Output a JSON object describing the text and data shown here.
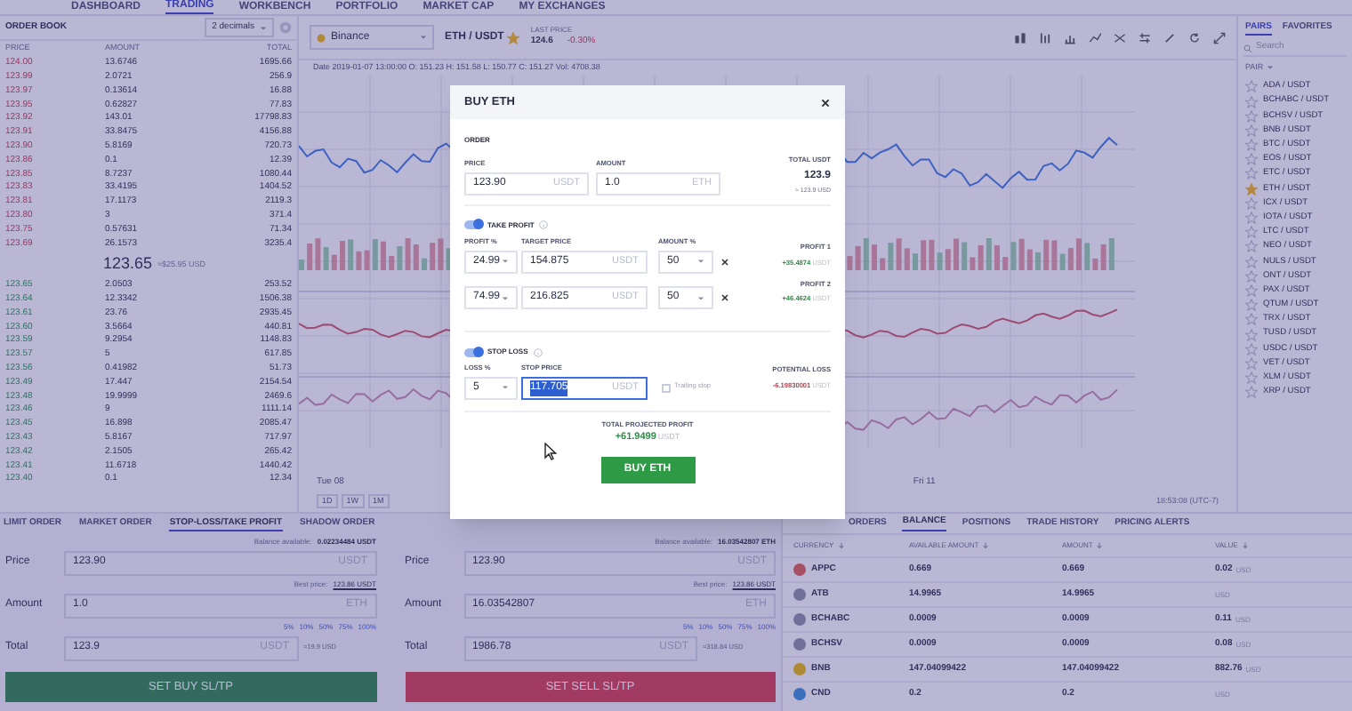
{
  "nav": [
    {
      "label": "DASHBOARD",
      "selected": false
    },
    {
      "label": "TRADING",
      "selected": true
    },
    {
      "label": "WORKBENCH",
      "selected": false
    },
    {
      "label": "PORTFOLIO",
      "selected": false
    },
    {
      "label": "MARKET CAP",
      "selected": false
    },
    {
      "label": "MY EXCHANGES",
      "selected": false
    }
  ],
  "order_book": {
    "title": "ORDER BOOK",
    "decimals": "2 decimals",
    "columns": [
      "PRICE",
      "AMOUNT",
      "TOTAL"
    ],
    "asks": [
      {
        "price": "124.00",
        "amount": "13.6746",
        "total": "1695.66"
      },
      {
        "price": "123.99",
        "amount": "2.0721",
        "total": "256.9"
      },
      {
        "price": "123.97",
        "amount": "0.13614",
        "total": "16.88"
      },
      {
        "price": "123.95",
        "amount": "0.62827",
        "total": "77.83"
      },
      {
        "price": "123.92",
        "amount": "143.01",
        "total": "17798.83"
      },
      {
        "price": "123.91",
        "amount": "33.8475",
        "total": "4156.88"
      },
      {
        "price": "123.90",
        "amount": "5.8169",
        "total": "720.73"
      },
      {
        "price": "123.86",
        "amount": "0.1",
        "total": "12.39"
      },
      {
        "price": "123.85",
        "amount": "8.7237",
        "total": "1080.44"
      },
      {
        "price": "123.83",
        "amount": "33.4195",
        "total": "1404.52"
      },
      {
        "price": "123.81",
        "amount": "17.1173",
        "total": "2119.3"
      },
      {
        "price": "123.80",
        "amount": "3",
        "total": "371.4"
      },
      {
        "price": "123.75",
        "amount": "0.57631",
        "total": "71.34"
      },
      {
        "price": "123.69",
        "amount": "26.1573",
        "total": "3235.4"
      }
    ],
    "last_price": "123.65",
    "last_price_usd": "≈$25.95 USD",
    "bids": [
      {
        "price": "123.65",
        "amount": "2.0503",
        "total": "253.52"
      },
      {
        "price": "123.64",
        "amount": "12.3342",
        "total": "1506.38"
      },
      {
        "price": "123.61",
        "amount": "23.76",
        "total": "2935.45"
      },
      {
        "price": "123.60",
        "amount": "3.5664",
        "total": "440.81"
      },
      {
        "price": "123.59",
        "amount": "9.2954",
        "total": "1148.83"
      },
      {
        "price": "123.57",
        "amount": "5",
        "total": "617.85"
      },
      {
        "price": "123.56",
        "amount": "0.41982",
        "total": "51.73"
      },
      {
        "price": "123.49",
        "amount": "17.447",
        "total": "2154.54"
      },
      {
        "price": "123.48",
        "amount": "19.9999",
        "total": "2469.6"
      },
      {
        "price": "123.46",
        "amount": "9",
        "total": "1111.14"
      },
      {
        "price": "123.45",
        "amount": "16.898",
        "total": "2085.47"
      },
      {
        "price": "123.43",
        "amount": "5.8167",
        "total": "717.97"
      },
      {
        "price": "123.42",
        "amount": "2.1505",
        "total": "265.42"
      },
      {
        "price": "123.41",
        "amount": "11.6718",
        "total": "1440.42"
      },
      {
        "price": "123.40",
        "amount": "0.1",
        "total": "12.34"
      }
    ]
  },
  "chart": {
    "exchange": "Binance",
    "pair": "ETH / USDT",
    "favorite": true,
    "last_price_label": "LAST PRICE",
    "last_price": "124.6",
    "change": "-0.30%",
    "ohlc": "Date 2019-01-07 13:00:00 O: 151.23 H: 151.58 L: 150.77 C: 151.27 Vol: 4708.38",
    "date_labels": [
      "Tue 08",
      "Fri 11"
    ],
    "timeframes": [
      "1D",
      "1W",
      "1M"
    ],
    "clock": "18:53:08 (UTC-7)"
  },
  "pairs": {
    "tabs": [
      {
        "label": "PAIRS",
        "selected": true
      },
      {
        "label": "FAVORITES",
        "selected": false
      }
    ],
    "search": {
      "placeholder": "Search"
    },
    "header": "PAIR",
    "items": [
      {
        "name": "ADA / USDT",
        "favorite": false
      },
      {
        "name": "BCHABC / USDT",
        "favorite": false
      },
      {
        "name": "BCHSV / USDT",
        "favorite": false
      },
      {
        "name": "BNB / USDT",
        "favorite": false
      },
      {
        "name": "BTC / USDT",
        "favorite": false
      },
      {
        "name": "EOS / USDT",
        "favorite": false
      },
      {
        "name": "ETC / USDT",
        "favorite": false
      },
      {
        "name": "ETH / USDT",
        "favorite": true
      },
      {
        "name": "ICX / USDT",
        "favorite": false
      },
      {
        "name": "IOTA / USDT",
        "favorite": false
      },
      {
        "name": "LTC / USDT",
        "favorite": false
      },
      {
        "name": "NEO / USDT",
        "favorite": false
      },
      {
        "name": "NULS / USDT",
        "favorite": false
      },
      {
        "name": "ONT / USDT",
        "favorite": false
      },
      {
        "name": "PAX / USDT",
        "favorite": false
      },
      {
        "name": "QTUM / USDT",
        "favorite": false
      },
      {
        "name": "TRX / USDT",
        "favorite": false
      },
      {
        "name": "TUSD / USDT",
        "favorite": false
      },
      {
        "name": "USDC / USDT",
        "favorite": false
      },
      {
        "name": "VET / USDT",
        "favorite": false
      },
      {
        "name": "XLM / USDT",
        "favorite": false
      },
      {
        "name": "XRP / USDT",
        "favorite": false
      }
    ]
  },
  "order_form": {
    "tabs": [
      {
        "label": "LIMIT ORDER",
        "selected": false
      },
      {
        "label": "MARKET ORDER",
        "selected": false
      },
      {
        "label": "STOP-LOSS/TAKE PROFIT",
        "selected": true
      },
      {
        "label": "SHADOW ORDER",
        "selected": false
      }
    ],
    "sides": [
      {
        "kind": "buy",
        "balance_label": "Balance available:",
        "balance": "0.02234484 USDT",
        "price_label": "Price",
        "price": "123.90",
        "price_unit": "USDT",
        "best_label": "Best price:",
        "best": "123.86 USDT",
        "amount_label": "Amount",
        "amount": "1.0",
        "amount_unit": "ETH",
        "percents": [
          "5%",
          "10%",
          "50%",
          "75%",
          "100%"
        ],
        "total_label": "Total",
        "total": "123.9",
        "total_unit": "USDT",
        "total_usd": "≈19.9 USD",
        "button": "SET BUY SL/TP"
      },
      {
        "kind": "sell",
        "balance_label": "Balance available:",
        "balance": "16.03542807 ETH",
        "price_label": "Price",
        "price": "123.90",
        "price_unit": "USDT",
        "best_label": "Best price:",
        "best": "123.86 USDT",
        "amount_label": "Amount",
        "amount": "16.03542807",
        "amount_unit": "ETH",
        "percents": [
          "5%",
          "10%",
          "50%",
          "75%",
          "100%"
        ],
        "total_label": "Total",
        "total": "1986.78",
        "total_unit": "USDT",
        "total_usd": "≈318.84 USD",
        "button": "SET SELL SL/TP"
      }
    ]
  },
  "account": {
    "tabs": [
      {
        "label": "ORDERS",
        "selected": false
      },
      {
        "label": "BALANCE",
        "selected": true
      },
      {
        "label": "POSITIONS",
        "selected": false
      },
      {
        "label": "TRADE HISTORY",
        "selected": false
      },
      {
        "label": "PRICING ALERTS",
        "selected": false
      }
    ],
    "columns": [
      "CURRENCY",
      "AVAILABLE AMOUNT",
      "AMOUNT",
      "VALUE"
    ],
    "rows": [
      {
        "currency": "APPC",
        "color": "#a65063",
        "available": "0.669",
        "amount": "0.669",
        "value": "0.02",
        "unit": "USD"
      },
      {
        "currency": "ATB",
        "color": "#71719b",
        "available": "14.9965",
        "amount": "14.9965",
        "value": "",
        "unit": "USD"
      },
      {
        "currency": "BCHABC",
        "color": "#71719b",
        "available": "0.0009",
        "amount": "0.0009",
        "value": "0.11",
        "unit": "USD"
      },
      {
        "currency": "BCHSV",
        "color": "#71719b",
        "available": "0.0009",
        "amount": "0.0009",
        "value": "0.08",
        "unit": "USD"
      },
      {
        "currency": "BNB",
        "color": "#b08936",
        "available": "147.04099422",
        "amount": "147.04099422",
        "value": "882.76",
        "unit": "USD"
      },
      {
        "currency": "CND",
        "color": "#3b6ebc",
        "available": "0.2",
        "amount": "0.2",
        "value": "",
        "unit": "USD"
      }
    ]
  },
  "modal": {
    "title": "BUY ETH",
    "order_label": "ORDER",
    "price": {
      "label": "PRICE",
      "value": "123.90",
      "unit": "USDT"
    },
    "amount": {
      "label": "AMOUNT",
      "value": "1.0",
      "unit": "ETH"
    },
    "total": {
      "label": "TOTAL USDT",
      "value": "123.9",
      "usd": "≈ 123.9 USD"
    },
    "take_profit": {
      "label": "TAKE PROFIT",
      "on": true,
      "columns": [
        "PROFIT %",
        "TARGET PRICE",
        "AMOUNT %"
      ],
      "targets": [
        {
          "percent": "24.99",
          "price": "154.875",
          "unit": "USDT",
          "amount": "50",
          "profit_label": "PROFIT 1",
          "profit": "+35.4874",
          "profit_unit": "USDT"
        },
        {
          "percent": "74.99",
          "price": "216.825",
          "unit": "USDT",
          "amount": "50",
          "profit_label": "PROFIT 2",
          "profit": "+46.4624",
          "profit_unit": "USDT"
        }
      ]
    },
    "stop_loss": {
      "label": "STOP LOSS",
      "on": true,
      "loss_label": "LOSS %",
      "loss": "5",
      "price_label": "STOP PRICE",
      "price": "117.705",
      "unit": "USDT",
      "focused": true,
      "trailing": {
        "label": "Trailing stop",
        "checked": false
      },
      "potential_label": "POTENTIAL LOSS",
      "potential": "-6.19830001",
      "potential_unit": "USDT"
    },
    "projected": {
      "label": "TOTAL PROJECTED PROFIT",
      "value": "+61.9499",
      "unit": "USDT"
    },
    "button": "BUY ETH"
  }
}
